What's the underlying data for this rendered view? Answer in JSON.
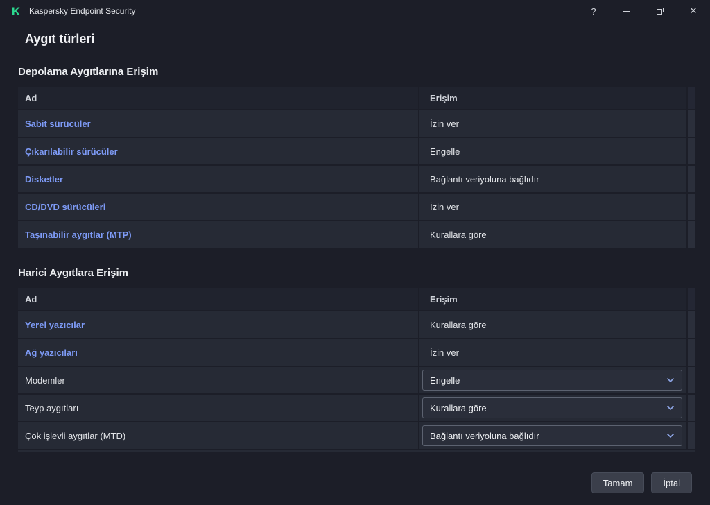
{
  "window": {
    "title": "Kaspersky Endpoint Security",
    "controls": {
      "help": "?",
      "close": "✕"
    }
  },
  "page": {
    "title": "Aygıt türleri"
  },
  "colors": {
    "background": "#1c1e28",
    "row": "#262a35",
    "link": "#7e9bf7",
    "logo_green": "#2bd98f"
  },
  "sections": [
    {
      "heading": "Depolama Aygıtlarına Erişim",
      "columns": {
        "name": "Ad",
        "access": "Erişim"
      },
      "rows": [
        {
          "name": "Sabit sürücüler",
          "access": "İzin ver"
        },
        {
          "name": "Çıkarılabilir sürücüler",
          "access": "Engelle"
        },
        {
          "name": "Disketler",
          "access": "Bağlantı veriyoluna bağlıdır"
        },
        {
          "name": "CD/DVD sürücüleri",
          "access": "İzin ver"
        },
        {
          "name": "Taşınabilir aygıtlar (MTP)",
          "access": "Kurallara göre"
        }
      ]
    },
    {
      "heading": "Harici Aygıtlara Erişim",
      "columns": {
        "name": "Ad",
        "access": "Erişim"
      },
      "rows": [
        {
          "name": "Yerel yazıcılar",
          "access": "Kurallara göre"
        },
        {
          "name": "Ağ yazıcıları",
          "access": "İzin ver"
        },
        {
          "name": "Modemler",
          "access": "Engelle"
        },
        {
          "name": "Teyp aygıtları",
          "access": "Kurallara göre"
        },
        {
          "name": "Çok işlevli aygıtlar (MTD)",
          "access": "Bağlantı veriyoluna bağlıdır"
        }
      ]
    }
  ],
  "footer": {
    "ok": "Tamam",
    "cancel": "İptal"
  }
}
